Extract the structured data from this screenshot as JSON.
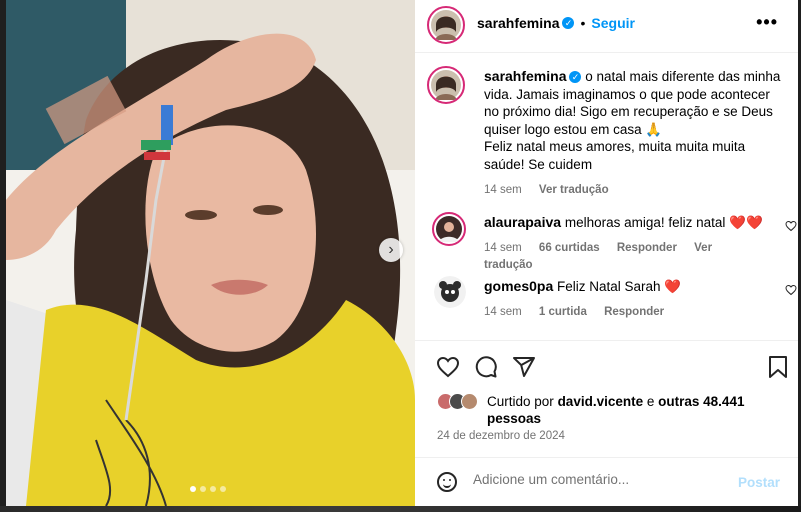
{
  "post": {
    "author": {
      "username": "sarahfemina",
      "verified_icon": "verified-badge-icon",
      "follow_label": "Seguir",
      "separator": "•"
    },
    "more_icon": "more-options-icon",
    "more_label": "•••",
    "carousel": {
      "next_icon": "chevron-right-icon",
      "next_label": "›",
      "slides_count": 4,
      "active_index": 0
    },
    "caption": {
      "username": "sarahfemina",
      "text_line1": "o natal mais diferente das minha vida. Jamais imaginamos o que pode acontecer no próximo dia! Sigo em recuperação e se Deus quiser logo estou em casa 🙏",
      "text_line2": "Feliz natal meus amores, muita muita muita saúde! Se cuidem",
      "time": "14 sem",
      "translate": "Ver tradução"
    },
    "comments": [
      {
        "username": "alaurapaiva",
        "text": "melhoras amiga! feliz natal ❤️❤️",
        "time": "14 sem",
        "likes": "66 curtidas",
        "reply": "Responder",
        "translate": "Ver tradução"
      },
      {
        "username": "gomes0pa",
        "text": "Feliz Natal Sarah ❤️",
        "time": "14 sem",
        "likes": "1 curtida",
        "reply": "Responder"
      }
    ],
    "actions": {
      "like_icon": "heart-icon",
      "comment_icon": "comment-icon",
      "share_icon": "share-icon",
      "save_icon": "bookmark-icon"
    },
    "likes": {
      "prefix": "Curtido por",
      "user": "david.vicente",
      "conj": "e",
      "others": "outras 48.441",
      "others_suffix": "pessoas"
    },
    "date": "24 de dezembro de 2024",
    "comment_box": {
      "emoji_icon": "emoji-icon",
      "placeholder": "Adicione um comentário...",
      "post_label": "Postar"
    },
    "colors": {
      "accent": "#0095f6",
      "heart_red": "#ed1c24",
      "muted": "#737373",
      "shirt_yellow": "#e8d12a"
    }
  }
}
